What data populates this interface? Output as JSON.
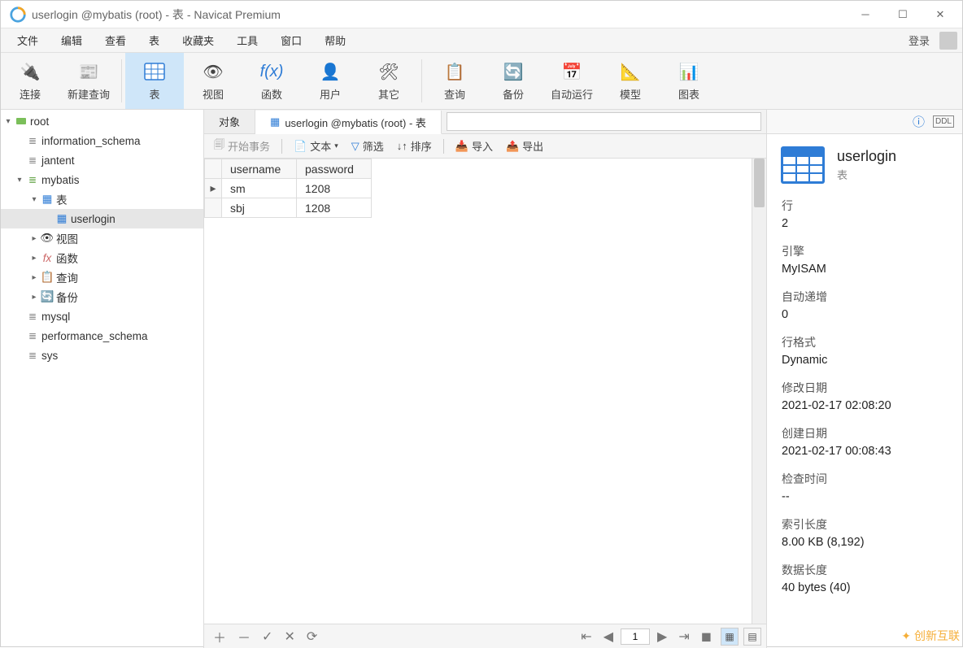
{
  "window": {
    "title": "userlogin @mybatis (root) - 表 - Navicat Premium"
  },
  "menu": {
    "items": [
      "文件",
      "编辑",
      "查看",
      "表",
      "收藏夹",
      "工具",
      "窗口",
      "帮助"
    ],
    "login": "登录"
  },
  "toolbar": {
    "conn": "连接",
    "newquery": "新建查询",
    "table": "表",
    "view": "视图",
    "func": "函数",
    "user": "用户",
    "other": "其它",
    "query": "查询",
    "backup": "备份",
    "auto": "自动运行",
    "model": "模型",
    "chart": "图表"
  },
  "tree": {
    "root": "root",
    "dbs": [
      "information_schema",
      "jantent"
    ],
    "mybatis": "mybatis",
    "tbl_group": "表",
    "userlogin": "userlogin",
    "nodes": {
      "view": "视图",
      "func": "函数",
      "query": "查询",
      "backup": "备份"
    },
    "others": [
      "mysql",
      "performance_schema",
      "sys"
    ]
  },
  "tabs": {
    "objects": "对象",
    "active": "userlogin @mybatis (root) - 表"
  },
  "table_toolbar": {
    "begin_tx": "开始事务",
    "text": "文本",
    "filter": "筛选",
    "sort": "排序",
    "import": "导入",
    "export": "导出"
  },
  "grid": {
    "headers": [
      "username",
      "password"
    ],
    "rows": [
      {
        "username": "sm",
        "password": "1208"
      },
      {
        "username": "sbj",
        "password": "1208"
      }
    ]
  },
  "status": {
    "page": "1"
  },
  "rightpanel": {
    "title": "userlogin",
    "subtitle": "表",
    "sections": [
      {
        "label": "行",
        "value": "2"
      },
      {
        "label": "引擎",
        "value": "MyISAM"
      },
      {
        "label": "自动递增",
        "value": "0"
      },
      {
        "label": "行格式",
        "value": "Dynamic"
      },
      {
        "label": "修改日期",
        "value": "2021-02-17 02:08:20"
      },
      {
        "label": "创建日期",
        "value": "2021-02-17 00:08:43"
      },
      {
        "label": "检查时间",
        "value": "--"
      },
      {
        "label": "索引长度",
        "value": "8.00 KB (8,192)"
      },
      {
        "label": "数据长度",
        "value": "40 bytes (40)"
      }
    ]
  },
  "watermark": "创新互联"
}
